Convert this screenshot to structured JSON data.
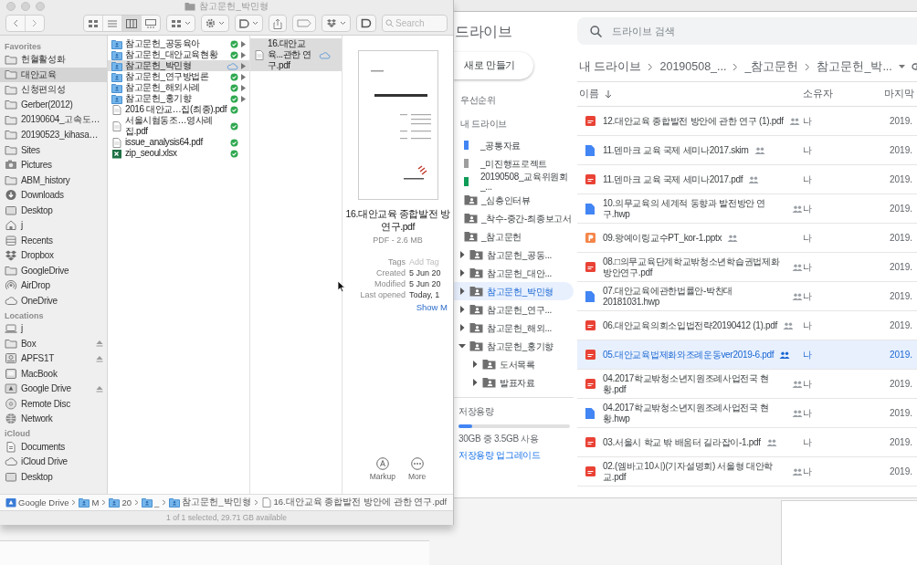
{
  "finder": {
    "title": "참고문헌_박민형",
    "view_modes": [
      {
        "kind": "icons",
        "selected": false
      },
      {
        "kind": "list",
        "selected": false
      },
      {
        "kind": "columns",
        "selected": true
      },
      {
        "kind": "gallery",
        "selected": false
      }
    ],
    "search": {
      "placeholder": "Search"
    },
    "sidebar": [
      {
        "heading": "Favorites",
        "items": [
          {
            "label": "헌혈활성화",
            "kind": "folder",
            "selected": false
          },
          {
            "label": "대안교육",
            "kind": "folder",
            "selected": true
          },
          {
            "label": "신청편의성",
            "kind": "folder",
            "selected": false
          },
          {
            "label": "Gerber(2012)",
            "kind": "folder",
            "selected": false
          },
          {
            "label": "20190604_고속도…",
            "kind": "folder",
            "selected": false
          },
          {
            "label": "20190523_kihasa…",
            "kind": "folder",
            "selected": false
          },
          {
            "label": "Sites",
            "kind": "folder",
            "selected": false
          },
          {
            "label": "Pictures",
            "kind": "pictures",
            "selected": false
          },
          {
            "label": "ABM_history",
            "kind": "folder",
            "selected": false
          },
          {
            "label": "Downloads",
            "kind": "downloads",
            "selected": false
          },
          {
            "label": "Desktop",
            "kind": "desktop",
            "selected": false
          },
          {
            "label": "j",
            "kind": "home",
            "selected": false
          },
          {
            "label": "Recents",
            "kind": "recents",
            "selected": false
          },
          {
            "label": "Dropbox",
            "kind": "dropbox",
            "selected": false
          },
          {
            "label": "GoogleDrive",
            "kind": "folder",
            "selected": false
          },
          {
            "label": "AirDrop",
            "kind": "airdrop",
            "selected": false
          },
          {
            "label": "OneDrive",
            "kind": "cloud",
            "selected": false
          }
        ]
      },
      {
        "heading": "Locations",
        "items": [
          {
            "label": "j",
            "kind": "laptop",
            "selected": false,
            "ejectable": false
          },
          {
            "label": "Box",
            "kind": "folder",
            "selected": false,
            "ejectable": true
          },
          {
            "label": "APFS1T",
            "kind": "volume",
            "selected": false,
            "ejectable": true
          },
          {
            "label": "MacBook",
            "kind": "computer",
            "selected": false,
            "ejectable": false
          },
          {
            "label": "Google Drive",
            "kind": "gdrive",
            "selected": false,
            "ejectable": true
          },
          {
            "label": "Remote Disc",
            "kind": "disc",
            "selected": false,
            "ejectable": false
          },
          {
            "label": "Network",
            "kind": "network",
            "selected": false,
            "ejectable": false
          }
        ]
      },
      {
        "heading": "iCloud",
        "items": [
          {
            "label": "Documents",
            "kind": "documents",
            "selected": false
          },
          {
            "label": "iCloud Drive",
            "kind": "cloud",
            "selected": false
          },
          {
            "label": "Desktop",
            "kind": "desktop",
            "selected": false
          }
        ]
      }
    ],
    "column_1": [
      {
        "name": "참고문헌_공동육아",
        "kind": "folder",
        "synced": true,
        "selected": false
      },
      {
        "name": "참고문헌_대안교육현황",
        "kind": "folder",
        "synced": true,
        "selected": false
      },
      {
        "name": "참고문헌_박민형",
        "kind": "folder",
        "synced": false,
        "selected": true
      },
      {
        "name": "참고문헌_연구방법론",
        "kind": "folder",
        "synced": true,
        "selected": false
      },
      {
        "name": "참고문헌_해외사례",
        "kind": "folder",
        "synced": true,
        "selected": false
      },
      {
        "name": "참고문헌_홍기향",
        "kind": "folder",
        "synced": true,
        "selected": false
      },
      {
        "name": "2016 대안교…집(최종).pdf",
        "kind": "pdf",
        "synced": true,
        "selected": false
      },
      {
        "name": "서울시혐동조…영사례집.pdf",
        "kind": "pdf",
        "synced": true,
        "selected": false
      },
      {
        "name": "issue_analysis64.pdf",
        "kind": "pdf",
        "synced": true,
        "selected": false
      },
      {
        "name": "zip_seoul.xlsx",
        "kind": "xlsx",
        "synced": true,
        "selected": false
      }
    ],
    "column_2": [
      {
        "name": "16.대안교육...관한 연구.pdf",
        "kind": "pdf",
        "synced": false,
        "selected": true
      }
    ],
    "preview": {
      "name_lines": [
        "16.대안교육 종합발전 방",
        "연구.pdf"
      ],
      "info": "PDF - 2.6 MB",
      "fields": [
        {
          "label": "Tags",
          "value": "Add Tag",
          "kind": "placeholder"
        },
        {
          "label": "Created",
          "value": "5 Jun 20",
          "kind": "text"
        },
        {
          "label": "Modified",
          "value": "5 Jun 20",
          "kind": "text"
        },
        {
          "label": "Last opened",
          "value": "Today, 1",
          "kind": "text"
        }
      ],
      "show_more": "Show M",
      "actions": [
        {
          "label": "Markup",
          "kind": "markup"
        },
        {
          "label": "More",
          "kind": "more"
        }
      ]
    },
    "path": [
      {
        "label": "Google Drive",
        "kind": "drive"
      },
      {
        "label": "M",
        "kind": "folder"
      },
      {
        "label": "20",
        "kind": "folder"
      },
      {
        "label": "_",
        "kind": "folder"
      },
      {
        "label": "참고문헌_박민형",
        "kind": "folder"
      },
      {
        "label": "16.대안교육 종합발전 방안에 관한 연구.pdf",
        "kind": "file"
      }
    ],
    "status_bar": "1 of 1 selected, 29.71 GB available"
  },
  "drive": {
    "title": "드라이브",
    "new_button": "새로 만들기",
    "nav": [
      {
        "label": "우선순위",
        "selected": false
      },
      {
        "label": "내 드라이브",
        "selected": false
      }
    ],
    "tree": [
      {
        "label": "_공통자료",
        "color": "#4285f4",
        "selected": false
      },
      {
        "label": "_미진행프로젝트",
        "color": "#9e9e9e",
        "selected": false
      },
      {
        "label": "20190508_교육위원회_...",
        "color": "#0f9d58",
        "selected": false
      },
      {
        "label": "_심층인터뷰",
        "selected": false
      },
      {
        "label": "_착수-중간-최종보고서",
        "selected": false
      },
      {
        "label": "_참고문헌",
        "selected": false,
        "children": [
          {
            "label": "참고문헌_공동...",
            "expanded": false,
            "selected": false
          },
          {
            "label": "참고문헌_대안...",
            "expanded": false,
            "selected": false
          },
          {
            "label": "참고문헌_박민형",
            "expanded": false,
            "selected": true
          },
          {
            "label": "참고문헌_연구...",
            "expanded": false,
            "selected": false
          },
          {
            "label": "참고문헌_해외...",
            "expanded": false,
            "selected": false
          },
          {
            "label": "참고문헌_홍기향",
            "expanded": true,
            "selected": false,
            "children": [
              {
                "label": "도서목록",
                "expanded": false,
                "selected": false
              },
              {
                "label": "발표자료",
                "expanded": false,
                "selected": false
              }
            ]
          }
        ]
      }
    ],
    "storage": {
      "label": "저장용량",
      "level": 0.12,
      "usage": "30GB 중 3.5GB 사용",
      "upgrade": "저장용량 업그레이드"
    },
    "search": {
      "placeholder": "드라이브 검색"
    },
    "breadcrumb": [
      "내 드라이브",
      "20190508_...",
      "_참고문헌",
      "참고문헌_박..."
    ],
    "columns": [
      "이름",
      "소유자",
      "마지막"
    ],
    "rows": [
      {
        "name": "12.대안교육 종합발전 방안에 관한 연구 (1).pdf",
        "kind": "pdf",
        "owner": "나",
        "modified": "2019.",
        "selected": false
      },
      {
        "name": "11.덴마크 교육 국제 세미나2017.skim",
        "kind": "doc",
        "owner": "나",
        "modified": "2019.",
        "selected": false
      },
      {
        "name": "11.덴마크 교육 국제 세미나2017.pdf",
        "kind": "pdf",
        "owner": "나",
        "modified": "2019.",
        "selected": false
      },
      {
        "name": "10.의무교육의 세계적 동향과 발전방안 연구.hwp",
        "kind": "doc",
        "owner": "나",
        "modified": "2019.",
        "selected": false
      },
      {
        "name": "09.왕예이링교수PT_kor-1.pptx",
        "kind": "slides",
        "owner": "나",
        "modified": "2019.",
        "selected": false
      },
      {
        "name": "08.□의무교육단계학교밖청소년학습권법제화방안연구.pdf",
        "kind": "pdf",
        "owner": "나",
        "modified": "2019.",
        "selected": false
      },
      {
        "name": "07.대안교육에관한법률안-박찬대20181031.hwp",
        "kind": "doc",
        "owner": "나",
        "modified": "2019.",
        "selected": false
      },
      {
        "name": "06.대안교육의회소입법전략20190412 (1).pdf",
        "kind": "pdf",
        "owner": "나",
        "modified": "2019.",
        "selected": false
      },
      {
        "name": "05.대안교육법제화와조례운동ver2019-6.pdf",
        "kind": "pdf",
        "owner": "나",
        "modified": "2019.",
        "selected": true
      },
      {
        "name": "04.2017학교밖청소년지원조례사업전국 현황.pdf",
        "kind": "pdf",
        "owner": "나",
        "modified": "2019.",
        "selected": false
      },
      {
        "name": "04.2017학교밖청소년지원조례사업전국 현황.hwp",
        "kind": "doc",
        "owner": "나",
        "modified": "2019.",
        "selected": false
      },
      {
        "name": "03.서울시 학교 밖 배움터 길라잡이-1.pdf",
        "kind": "pdf",
        "owner": "나",
        "modified": "2019.",
        "selected": false
      },
      {
        "name": "02.(엠바고10시)(기자설명회) 서울형 대안학교.pdf",
        "kind": "pdf",
        "owner": "나",
        "modified": "2019.",
        "selected": false
      }
    ]
  }
}
